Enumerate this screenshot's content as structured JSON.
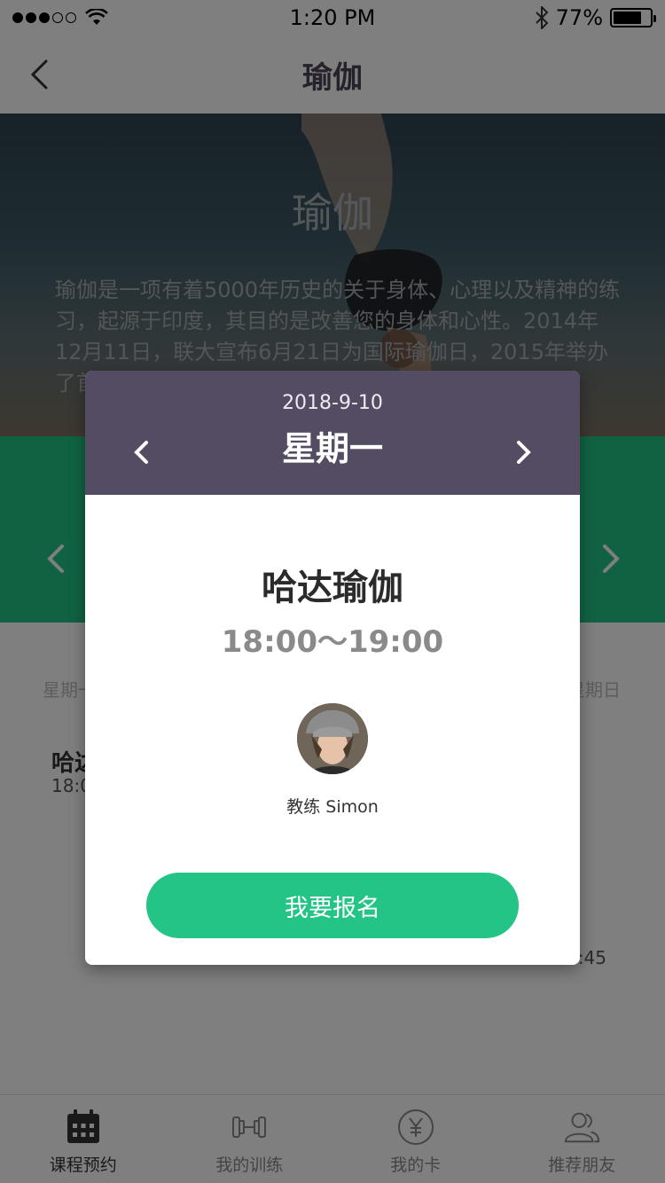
{
  "status_bar": {
    "time": "1:20 PM",
    "battery": "77%",
    "battery_level": 0.77
  },
  "nav": {
    "title": "瑜伽"
  },
  "hero": {
    "title": "瑜伽",
    "description": "瑜伽是一项有着5000年历史的关于身体、心理以及精神的练习，起源于印度，其目的是改善您的身体和心性。2014年12月11日，联大宣布6月21日为国际瑜伽日，2015年举办了首届6·21国际瑜伽日。"
  },
  "schedule_background": {
    "week_start": "星期一",
    "week_end": "星期日",
    "class_name": "哈达",
    "class_time": "18:0",
    "other_time": ":45"
  },
  "modal": {
    "date": "2018-9-10",
    "weekday": "星期一",
    "class_name": "哈达瑜伽",
    "time_range": "18:00～19:00",
    "coach": "教练 Simon",
    "signup_label": "我要报名"
  },
  "tabs": [
    {
      "label": "课程预约",
      "icon": "calendar-icon",
      "active": true
    },
    {
      "label": "我的训练",
      "icon": "dumbbell-icon",
      "active": false
    },
    {
      "label": "我的卡",
      "icon": "yen-card-icon",
      "active": false
    },
    {
      "label": "推荐朋友",
      "icon": "friends-icon",
      "active": false
    }
  ],
  "colors": {
    "accent_green": "#23c486",
    "modal_header": "#544c62",
    "nav_title": "#4a4458"
  }
}
